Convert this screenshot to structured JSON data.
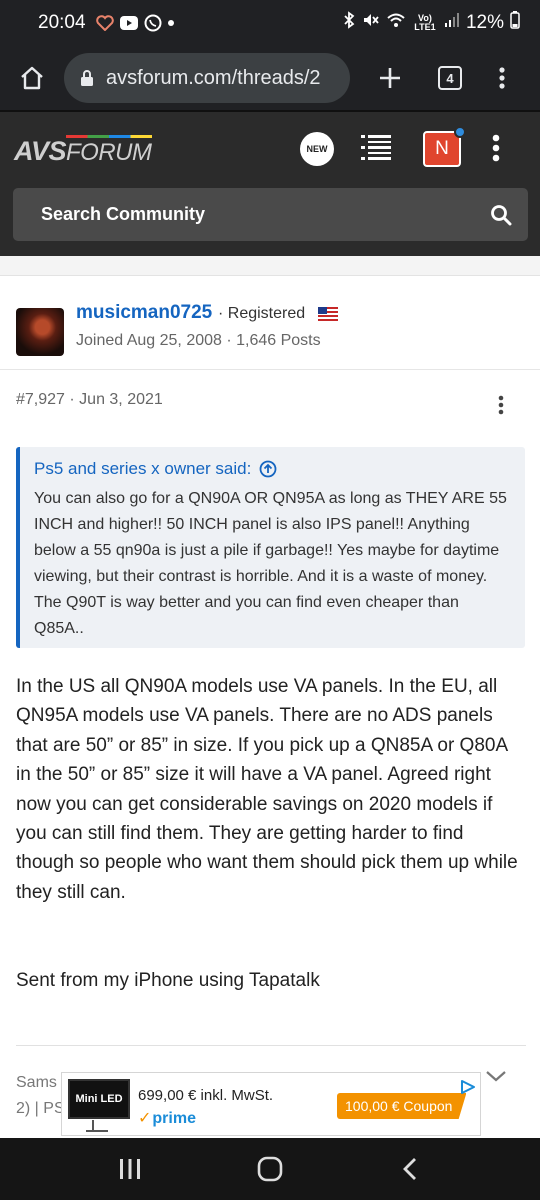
{
  "status_bar": {
    "time": "20:04",
    "network_label": "Vo) LTE1",
    "battery": "12%"
  },
  "browser": {
    "url": "avsforum.com/threads/2",
    "tab_count": "4"
  },
  "site": {
    "logo_bold": "AVS",
    "logo_light": "FORUM",
    "new_label": "NEW",
    "user_initial": "N",
    "search_placeholder": "Search Community"
  },
  "post": {
    "username": "musicman0725",
    "role": "· Registered",
    "joined": "Joined Aug 25, 2008 · 1,646 Posts",
    "number": "#7,927",
    "date": "· Jun 3, 2021",
    "quote": {
      "author_line": "Ps5 and series x owner said:",
      "text": "You can also go for a QN90A OR QN95A as long as THEY ARE 55 INCH and higher!! 50 INCH panel is also IPS panel!! Anything below a 55 qn90a is just a pile if garbage!! Yes maybe for daytime viewing, but their contrast is horrible. And it is a waste of money. The Q90T is way better and you can find even cheaper than Q85A.."
    },
    "body": "In the US all QN90A models use VA panels. In the EU, all QN95A models use VA panels. There are no ADS panels that are 50” or 85” in size. If you pick up a QN85A or Q80A in the 50” or 85” size it will have a VA panel. Agreed right now you can get considerable savings on 2020 models if you can still find them. They are getting harder to find though so people who want them should pick them up while they still can.",
    "sent_from": "Sent from my iPhone using Tapatalk",
    "signature_line1": "Sams",
    "signature_line2": "2) | PS"
  },
  "ad": {
    "thumb_label": "Mini LED",
    "price": "699,00 € inkl. MwSt.",
    "prime": "prime",
    "coupon": "100,00 € Coupon"
  },
  "colors": {
    "link_blue": "#1565c0",
    "header_bg": "#2b2b2b",
    "browser_bg": "#202124",
    "coupon_orange": "#f39200"
  }
}
